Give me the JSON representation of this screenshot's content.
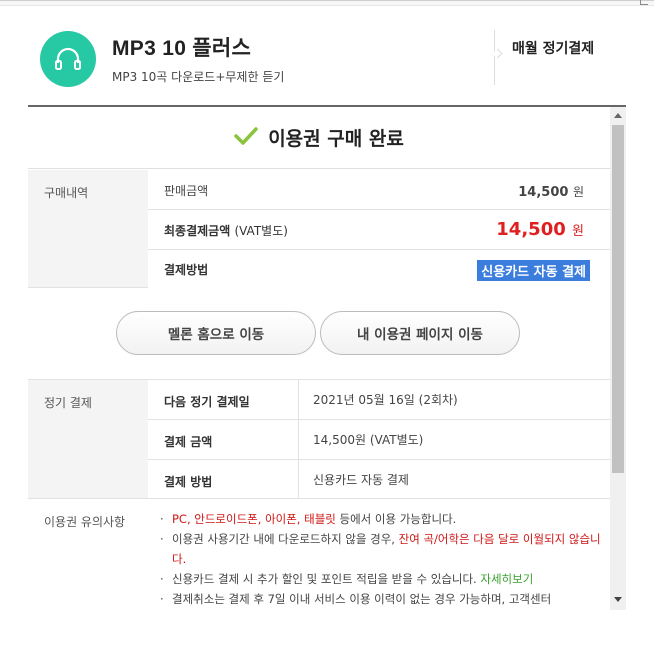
{
  "header": {
    "title": "MP3 10 플러스",
    "subtitle": "MP3 10곡 다운로드+무제한 듣기",
    "period": "매월 정기결제",
    "logo_icon": "headphones-icon",
    "brand_color": "#27c9a4"
  },
  "complete": {
    "text": "이용권 구매 완료",
    "icon": "check-icon",
    "icon_color": "#8ac43f"
  },
  "purchase": {
    "label": "구매내역",
    "rows": [
      {
        "key": "판매금액",
        "value": "14,500",
        "unit": "원"
      },
      {
        "key": "최종결제금액",
        "key_suffix": "(VAT별도)",
        "value": "14,500",
        "unit": "원"
      },
      {
        "key": "결제방법",
        "value": "신용카드 자동 결제"
      }
    ],
    "price_color": "#e02020"
  },
  "buttons": {
    "home": "멜론 홈으로 이동",
    "my_pass": "내 이용권 페이지 이동"
  },
  "regular": {
    "label": "정기 결제",
    "rows": [
      {
        "key": "다음 정기 결제일",
        "value": "2021년 05월 16일 (2회차)"
      },
      {
        "key": "결제 금액",
        "value": "14,500원 (VAT별도)"
      },
      {
        "key": "결제 방법",
        "value": "신용카드 자동 결제"
      }
    ]
  },
  "notice": {
    "label": "이용권 유의사항",
    "n1_devices": "PC, 안드로이드폰, 아이폰, 태블릿",
    "n1_rest": " 등에서 이용 가능합니다.",
    "n2_a": "이용권 사용기간 내에 다운로드하지 않을 경우, ",
    "n2_b": "잔여 곡/어학은 다음 달로 이월되지 않습니다.",
    "n3_a": "신용카드 결제 시 추가 할인 및 포인트 적립을 받을 수 있습니다. ",
    "n3_link": "자세히보기",
    "n4": "결제취소는 결제 후 7일 이내 서비스 이용 이력이 없는 경우 가능하며, 고객센터"
  }
}
